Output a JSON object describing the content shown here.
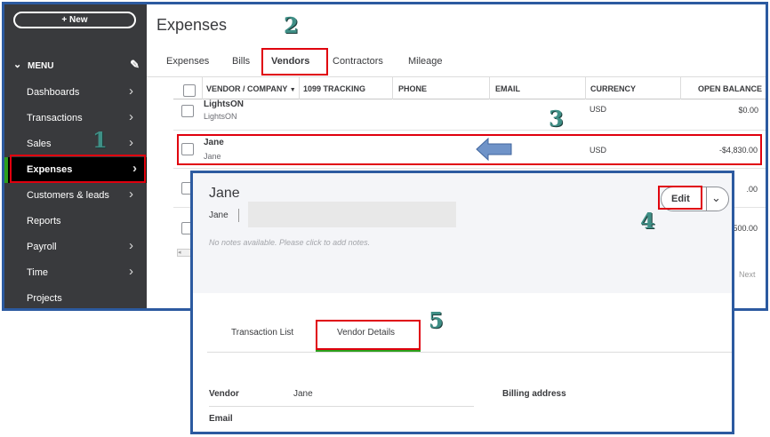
{
  "sidebar": {
    "new_label": "+ New",
    "menu_label": "MENU",
    "items": [
      {
        "label": "Dashboards",
        "has_chevron": true
      },
      {
        "label": "Transactions",
        "has_chevron": true
      },
      {
        "label": "Sales",
        "has_chevron": true
      },
      {
        "label": "Expenses",
        "has_chevron": true,
        "active": true
      },
      {
        "label": "Customers & leads",
        "has_chevron": true
      },
      {
        "label": "Reports",
        "has_chevron": false
      },
      {
        "label": "Payroll",
        "has_chevron": true
      },
      {
        "label": "Time",
        "has_chevron": true
      },
      {
        "label": "Projects",
        "has_chevron": false
      }
    ]
  },
  "header": {
    "title": "Expenses",
    "tabs": [
      "Expenses",
      "Bills",
      "Vendors",
      "Contractors",
      "Mileage"
    ],
    "active_tab": "Vendors"
  },
  "table": {
    "columns": [
      "VENDOR / COMPANY",
      "1099 TRACKING",
      "PHONE",
      "EMAIL",
      "CURRENCY",
      "OPEN BALANCE"
    ],
    "rows": [
      {
        "name": "LightsON",
        "company": "LightsON",
        "currency": "USD",
        "balance": "$0.00"
      },
      {
        "name": "Jane",
        "company": "Jane",
        "currency": "USD",
        "balance": "-$4,830.00"
      }
    ],
    "partial_balances": [
      ".00",
      "500.00"
    ],
    "next_label": "Next"
  },
  "popup": {
    "name": "Jane",
    "subtitle": "Jane",
    "notes_placeholder": "No notes available. Please click to add notes.",
    "edit_label": "Edit",
    "tabs": [
      "Transaction List",
      "Vendor Details"
    ],
    "active_tab": "Vendor Details",
    "details": {
      "vendor_label": "Vendor",
      "vendor_value": "Jane",
      "billing_label": "Billing address",
      "email_label": "Email"
    }
  },
  "annotations": {
    "step_numbers": [
      "1",
      "2",
      "3",
      "4",
      "5"
    ],
    "highlight_color": "#e0000e",
    "number_color": "#3f8f86",
    "frame_color": "#2c5aa0"
  },
  "colors": {
    "sidebar_bg": "#393a3d",
    "accent_green": "#2ca01c"
  }
}
